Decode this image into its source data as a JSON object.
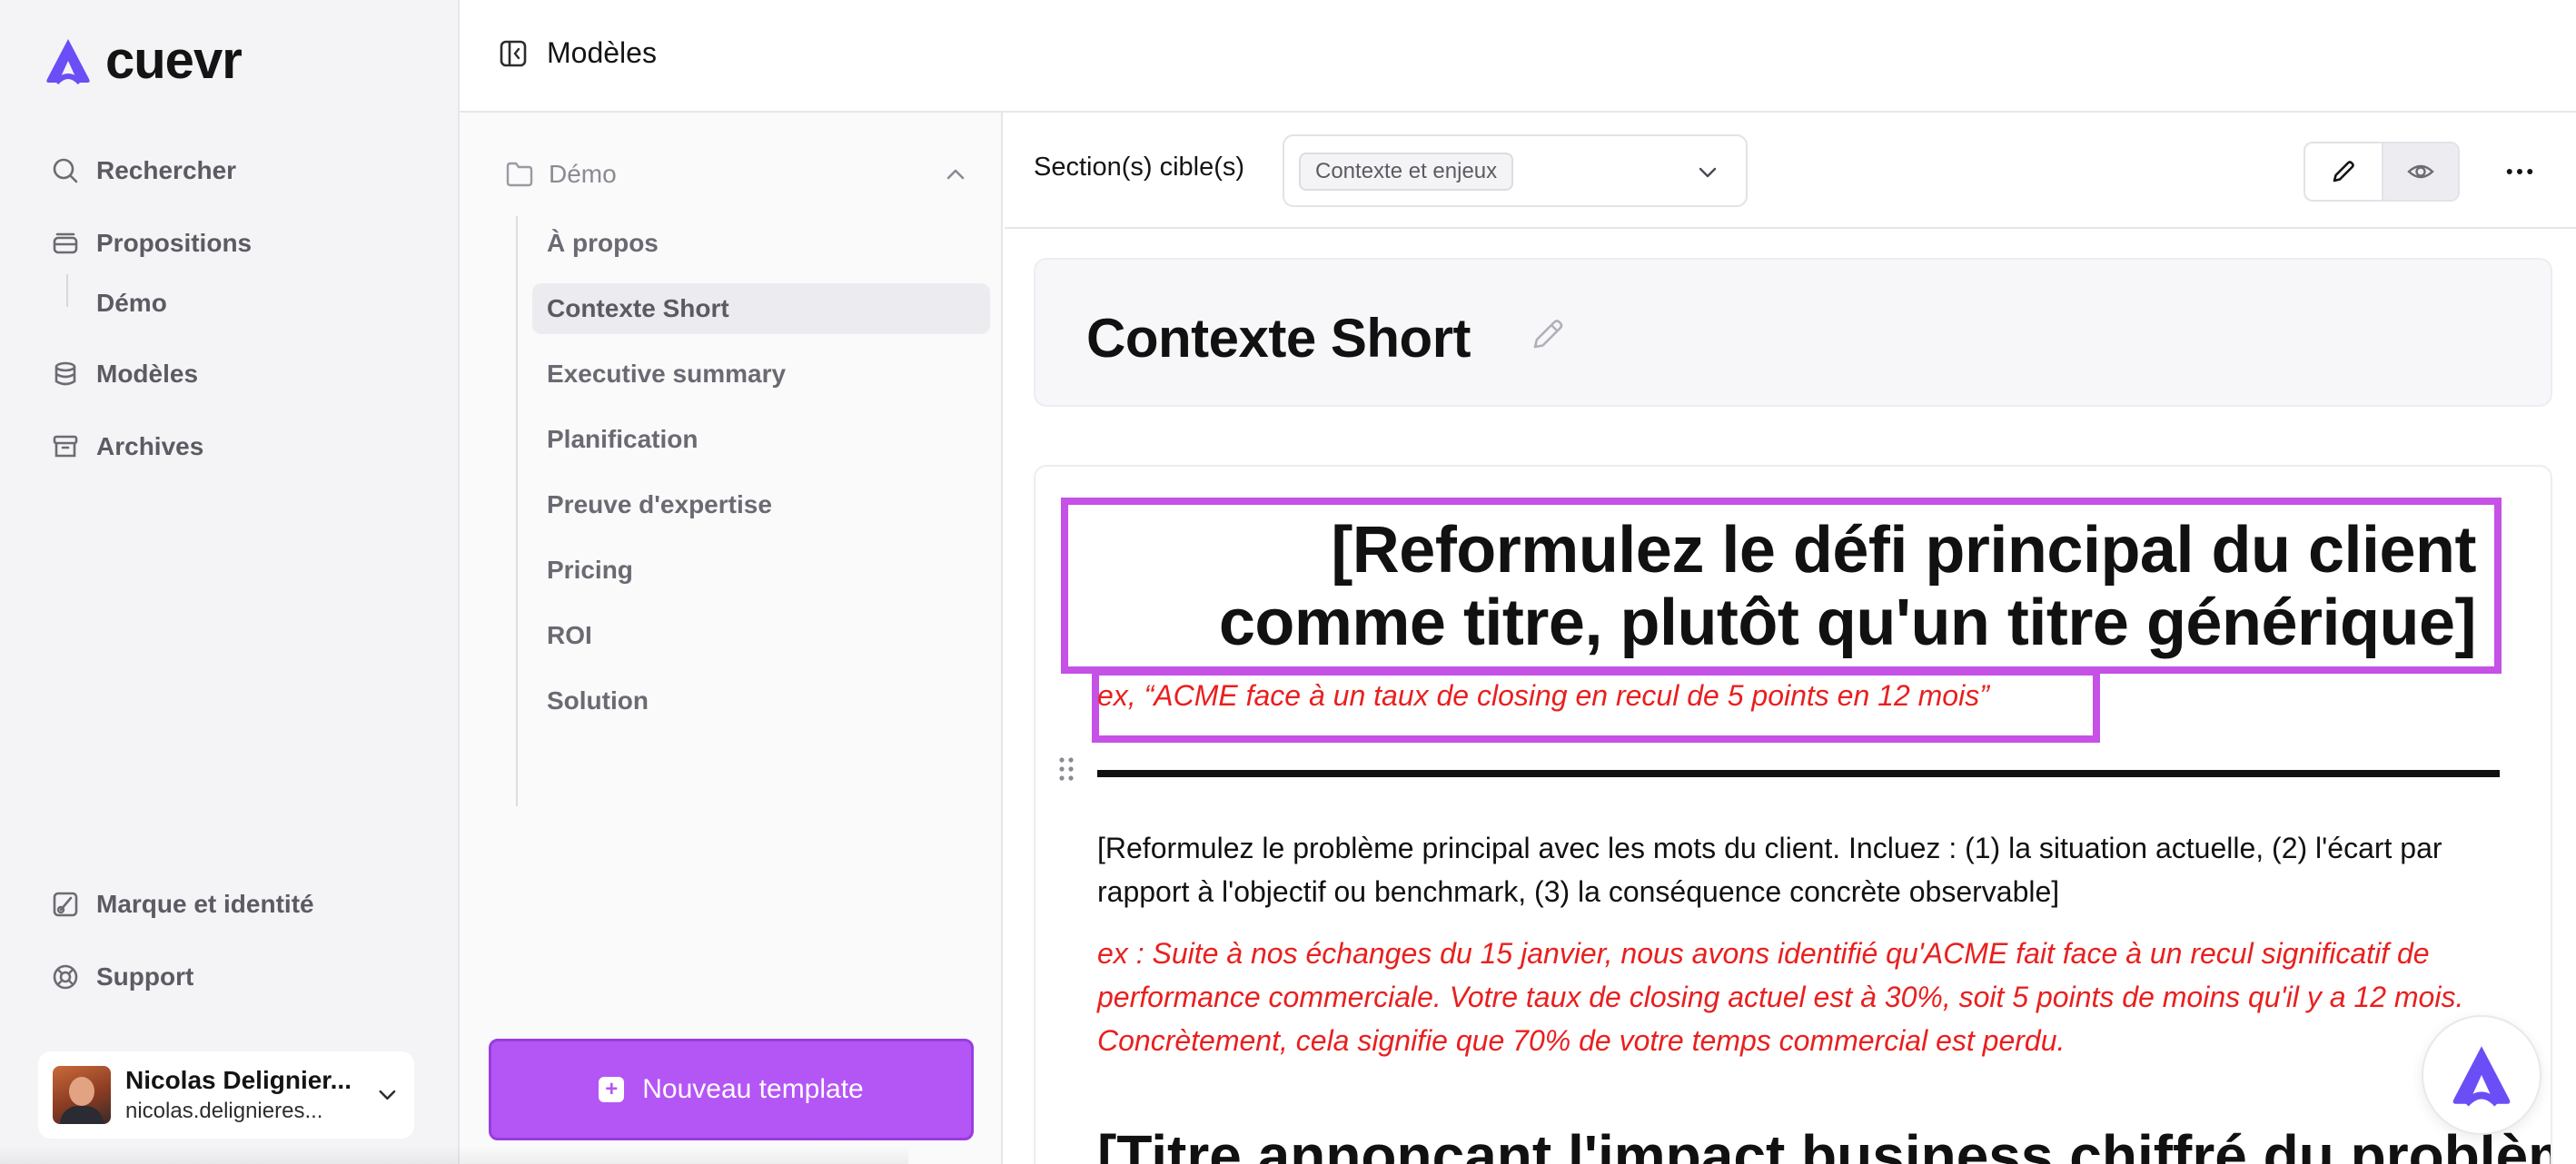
{
  "app": {
    "name": "cuevr",
    "brand_color": "#6b4ef6"
  },
  "sidebar": {
    "nav": [
      {
        "label": "Rechercher",
        "icon": "search-icon"
      },
      {
        "label": "Propositions",
        "icon": "stack-icon"
      },
      {
        "label": "Modèles",
        "icon": "database-icon"
      },
      {
        "label": "Archives",
        "icon": "archive-icon"
      }
    ],
    "sub_item": "Démo",
    "bottom": [
      {
        "label": "Marque et identité",
        "icon": "brand-icon"
      },
      {
        "label": "Support",
        "icon": "lifebuoy-icon"
      }
    ],
    "user": {
      "name": "Nicolas Delignier...",
      "email": "nicolas.delignieres..."
    }
  },
  "topbar": {
    "title": "Modèles"
  },
  "templates": {
    "folder": "Démo",
    "items": [
      "À propos",
      "Contexte Short",
      "Executive summary",
      "Planification",
      "Preuve d'expertise",
      "Pricing",
      "ROI",
      "Solution"
    ],
    "active": "Contexte Short",
    "new_button": "Nouveau template",
    "accent": "#b455f5"
  },
  "editor": {
    "section_label": "Section(s) cible(s)",
    "section_chip": "Contexte et enjeux",
    "title": "Contexte Short",
    "heading": "[Reformulez le défi principal du client comme titre, plutôt qu'un titre générique]",
    "example_1": "ex, “ACME face à un taux de closing en recul de 5 points en 12 mois”",
    "paragraph": "[Reformulez le problème principal avec les mots du client. Incluez : (1) la situation actuelle, (2) l'écart par rapport à l'objectif ou benchmark, (3) la conséquence concrète observable]",
    "example_2": "ex : Suite à nos échanges du 15 janvier, nous avons identifié qu'ACME fait face à un recul significatif de performance commerciale. Votre taux de closing actuel est à 30%, soit 5 points de moins qu'il y a 12 mois. Concrètement, cela signifie que 70% de votre temps commercial est perdu.",
    "heading_2": "[Titre annonçant l'impact business chiffré du problème]",
    "example_color": "#e8201f",
    "highlight_color": "#c651e6"
  }
}
